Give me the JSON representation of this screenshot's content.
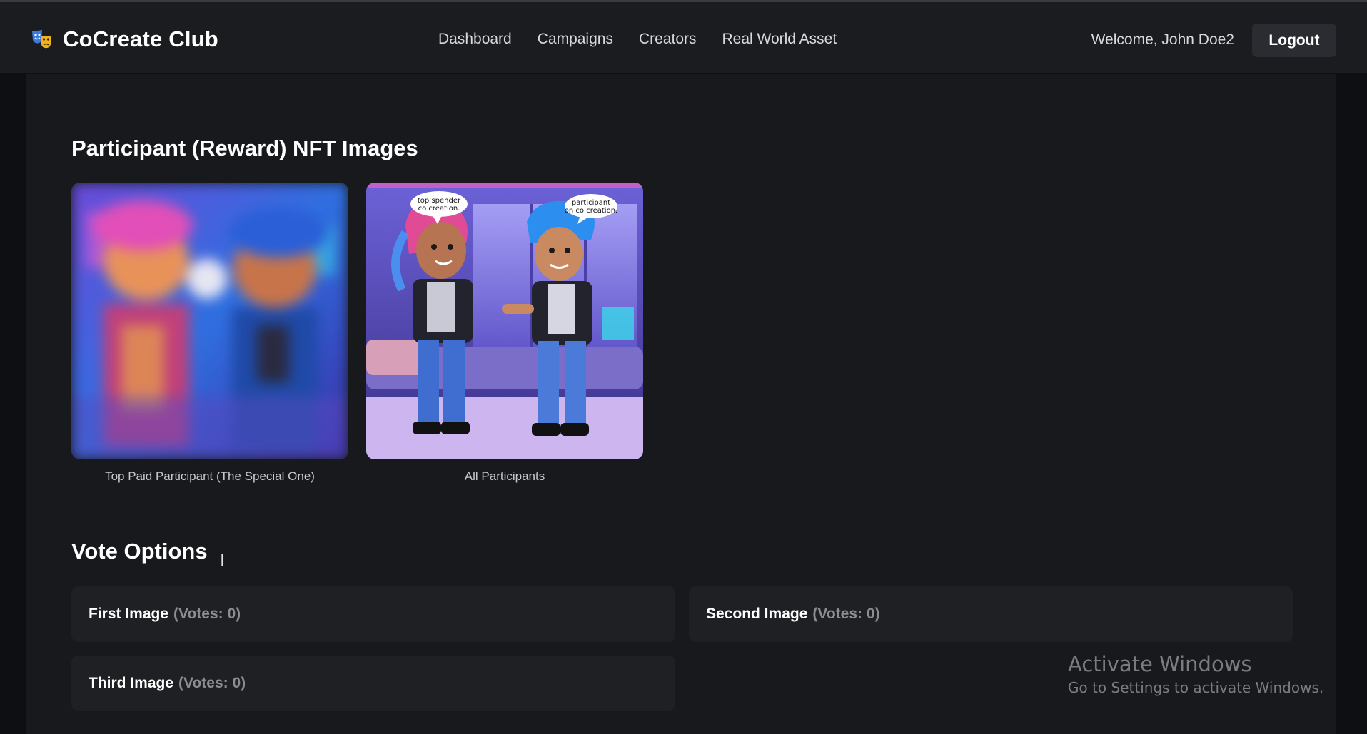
{
  "brand": {
    "name": "CoCreate Club",
    "logo_icon": "theater-masks-icon"
  },
  "nav": {
    "items": [
      "Dashboard",
      "Campaigns",
      "Creators",
      "Real World Asset"
    ]
  },
  "user": {
    "welcome": "Welcome, John Doe2",
    "logout_label": "Logout"
  },
  "nft_section": {
    "title": "Participant (Reward) NFT Images",
    "images": [
      {
        "caption": "Top Paid Participant (The Special One)",
        "blurred": true
      },
      {
        "caption": "All Participants",
        "blurred": false,
        "bubble_left": "top spender co creation.",
        "bubble_right": "participant on co creation."
      }
    ]
  },
  "vote_section": {
    "title": "Vote Options",
    "options": [
      {
        "name": "First Image",
        "votes": "(Votes: 0)"
      },
      {
        "name": "Second Image",
        "votes": "(Votes: 0)"
      },
      {
        "name": "Third Image",
        "votes": "(Votes: 0)"
      }
    ]
  },
  "watermark": {
    "line1": "Activate Windows",
    "line2": "Go to Settings to activate Windows."
  },
  "colors": {
    "background": "#18191d",
    "topbar": "#1b1c20",
    "card": "#1f2024",
    "accent_pink": "#e0458f",
    "accent_blue": "#2c8ff0"
  }
}
